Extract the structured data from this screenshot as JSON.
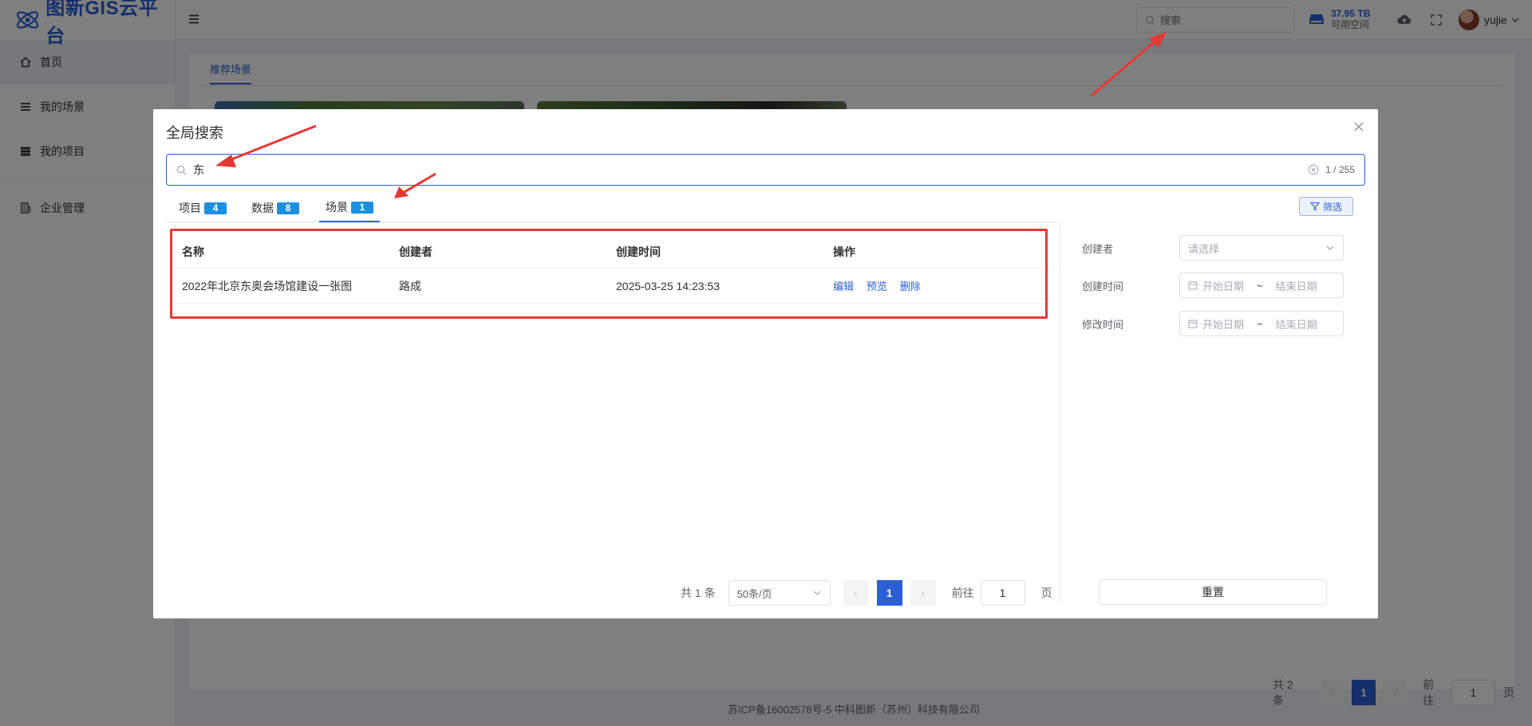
{
  "app": {
    "logo_text": "图新GIS云平台"
  },
  "sidebar": {
    "items": [
      {
        "label": "首页",
        "icon": "home-icon",
        "active": true
      },
      {
        "label": "我的场景",
        "icon": "list-icon",
        "active": false
      },
      {
        "label": "我的项目",
        "icon": "stack-icon",
        "active": false
      },
      {
        "label": "企业管理",
        "icon": "building-icon",
        "active": false
      }
    ]
  },
  "header": {
    "search_placeholder": "搜索",
    "storage_size": "37.95 TB",
    "storage_label": "可用空间",
    "username": "yujie"
  },
  "main": {
    "tab_label": "推荐场景",
    "pager": {
      "total": "共 2 条",
      "current": "1",
      "goto_label": "前往",
      "goto_value": "1",
      "page_suffix": "页"
    }
  },
  "footer": {
    "text": "苏ICP备16002578号-5 中科图新（苏州）科技有限公司"
  },
  "dialog": {
    "title": "全局搜索",
    "search_value": "东",
    "search_count": "1 / 255",
    "tabs": [
      {
        "label": "项目",
        "count": "4"
      },
      {
        "label": "数据",
        "count": "8"
      },
      {
        "label": "场景",
        "count": "1"
      }
    ],
    "filter_label": "筛选",
    "table": {
      "headers": [
        "名称",
        "创建者",
        "创建时间",
        "操作"
      ],
      "rows": [
        {
          "name": "2022年北京东奥会场馆建设一张图",
          "creator": "路成",
          "created": "2025-03-25 14:23:53",
          "actions": [
            "编辑",
            "预览",
            "删除"
          ]
        }
      ]
    },
    "pager": {
      "total": "共 1 条",
      "page_size": "50条/页",
      "current": "1",
      "goto_label": "前往",
      "goto_value": "1",
      "page_suffix": "页"
    },
    "filters": {
      "creator_label": "创建者",
      "creator_placeholder": "请选择",
      "created_label": "创建时间",
      "modified_label": "修改时间",
      "start_placeholder": "开始日期",
      "end_placeholder": "结束日期",
      "range_sep": "~",
      "reset_label": "重置"
    }
  },
  "colors": {
    "accent": "#2b5fd6",
    "badge": "#1d8fe1",
    "annotation": "#e53935"
  }
}
